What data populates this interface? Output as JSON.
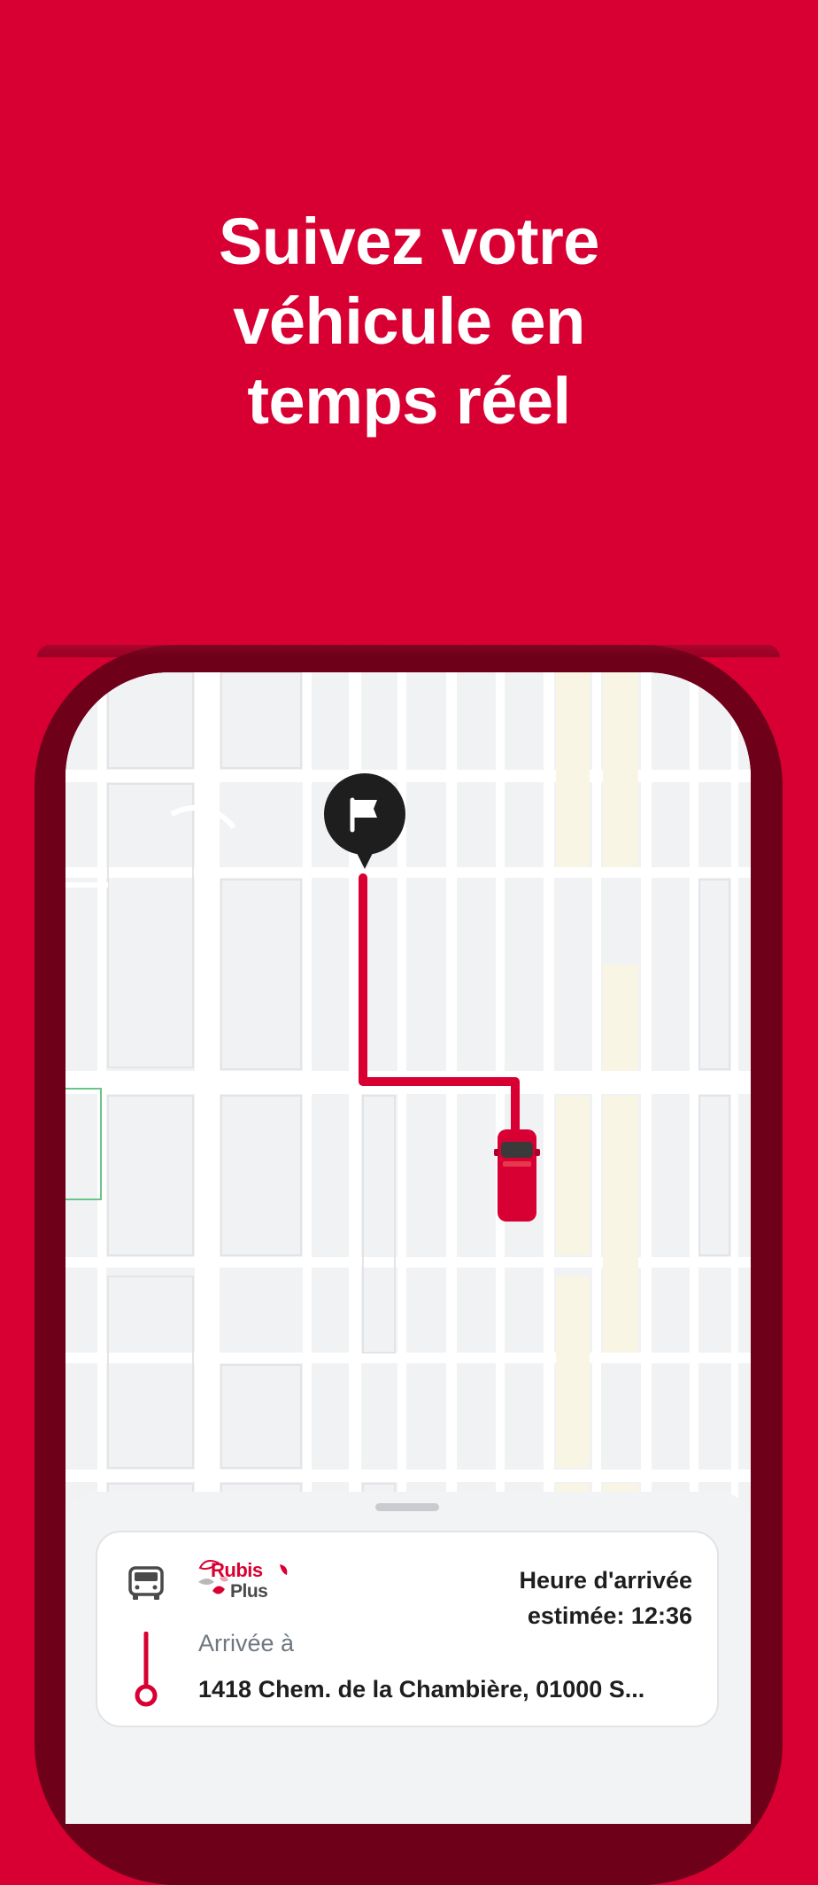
{
  "headline": {
    "line1": "Suivez votre",
    "line2": "véhicule en",
    "line3": "temps réel"
  },
  "colors": {
    "brand_red": "#D80032",
    "frame_dark": "#6E0019",
    "map_bg": "#F1F2F3",
    "route": "#D80032",
    "pin": "#1E1E1E"
  },
  "icons": {
    "destination": "flag-icon",
    "vehicle": "car-icon",
    "van": "van-icon",
    "route_line": "route-line-icon"
  },
  "logo": {
    "line1": "Rubis",
    "line2": "Plus"
  },
  "trip": {
    "eta_line1": "Heure d'arrivée",
    "eta_line2": "estimée: 12:36",
    "arrive_label": "Arrivée à",
    "address": "1418 Chem. de la Chambière, 01000 S..."
  }
}
